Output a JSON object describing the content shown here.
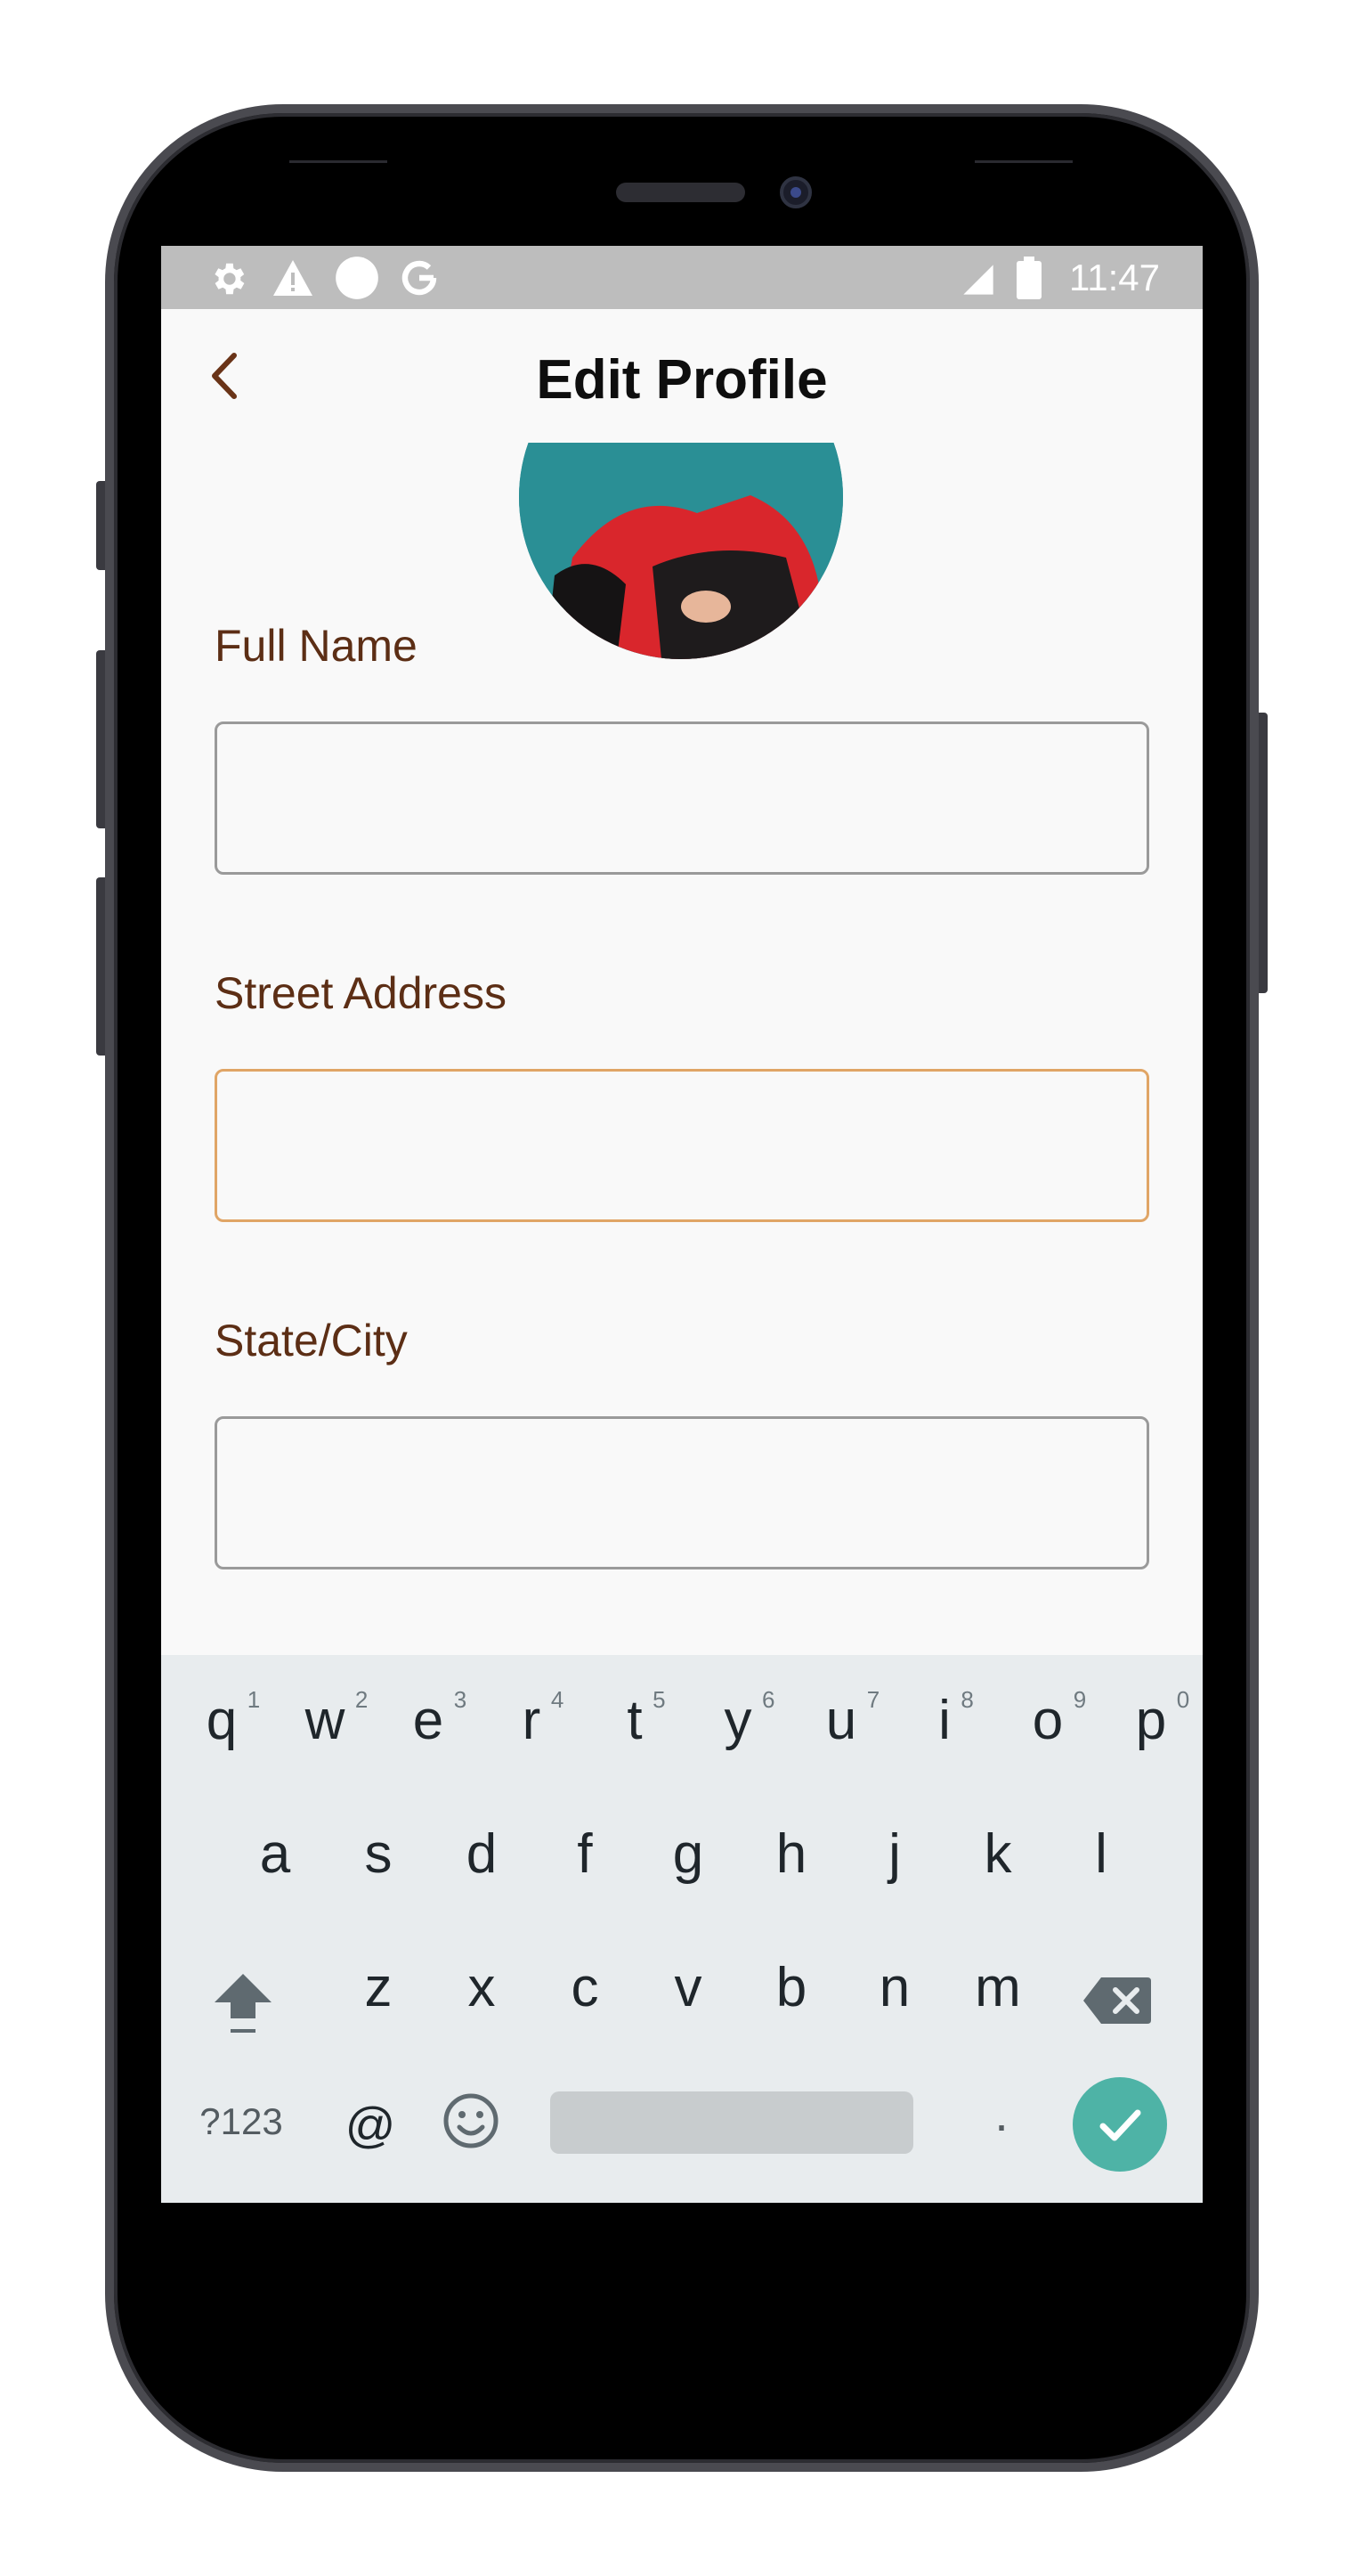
{
  "status_bar": {
    "time": "11:47",
    "left_icons": [
      "gear-icon",
      "warning-icon",
      "circle-icon",
      "google-icon"
    ],
    "right_icons": [
      "signal-icon",
      "battery-icon"
    ]
  },
  "header": {
    "title": "Edit Profile",
    "back_icon": "chevron-left-icon"
  },
  "form": {
    "full_name_label": "Full Name",
    "full_name_value": "",
    "street_address_label": "Street Address",
    "street_address_value": "",
    "state_city_label": "State/City",
    "state_city_value": ""
  },
  "keyboard": {
    "row1": [
      {
        "key": "q",
        "num": "1"
      },
      {
        "key": "w",
        "num": "2"
      },
      {
        "key": "e",
        "num": "3"
      },
      {
        "key": "r",
        "num": "4"
      },
      {
        "key": "t",
        "num": "5"
      },
      {
        "key": "y",
        "num": "6"
      },
      {
        "key": "u",
        "num": "7"
      },
      {
        "key": "i",
        "num": "8"
      },
      {
        "key": "o",
        "num": "9"
      },
      {
        "key": "p",
        "num": "0"
      }
    ],
    "row2": [
      "a",
      "s",
      "d",
      "f",
      "g",
      "h",
      "j",
      "k",
      "l"
    ],
    "row3": [
      "z",
      "x",
      "c",
      "v",
      "b",
      "n",
      "m"
    ],
    "symbols_label": "?123",
    "at_label": "@",
    "period_label": "."
  },
  "colors": {
    "accent_label": "#5c2e15",
    "focus_border": "#e0a566",
    "enter_key": "#4eb3a6"
  }
}
